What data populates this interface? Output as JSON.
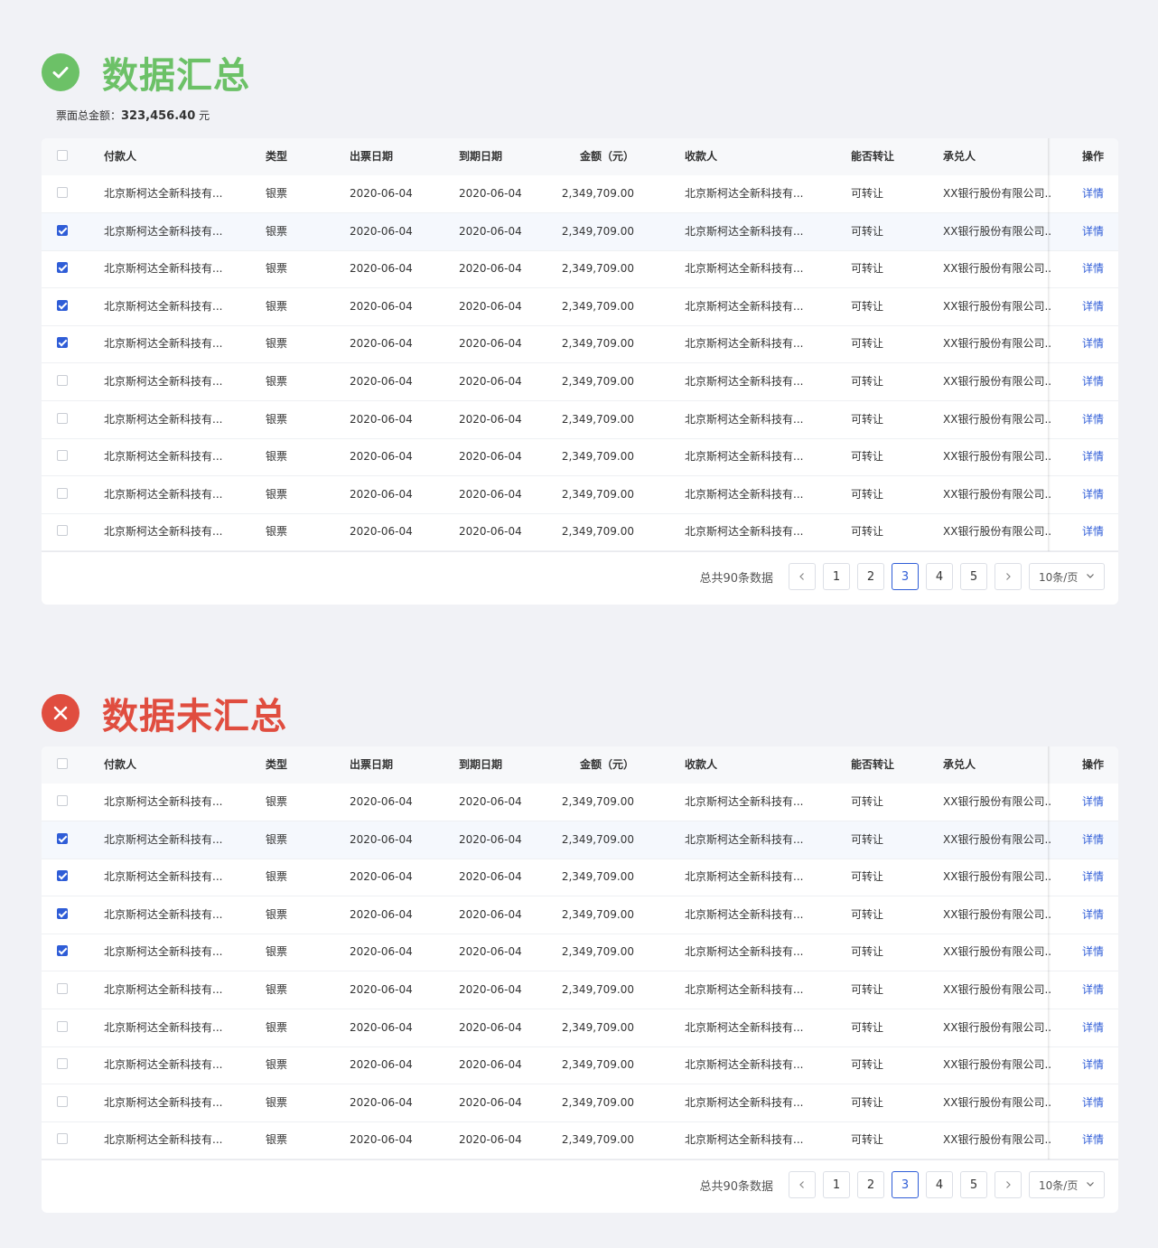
{
  "colors": {
    "success": "#6cc167",
    "error": "#e04d3f",
    "primary": "#2f5dd7"
  },
  "sections": [
    {
      "status": "success",
      "status_icon": "check-icon",
      "title": "数据汇总",
      "summary": {
        "label": "票面总金额：",
        "amount": "323,456.40",
        "unit": " 元"
      },
      "checked_rows": [
        1,
        2,
        3,
        4
      ],
      "highlight_row": 1
    },
    {
      "status": "error",
      "status_icon": "close-icon",
      "title": "数据未汇总",
      "checked_rows": [
        1,
        2,
        3,
        4
      ],
      "highlight_row": 1
    }
  ],
  "table": {
    "headers": {
      "payer": "付款人",
      "type": "类型",
      "issue_date": "出票日期",
      "due_date": "到期日期",
      "amount": "金额（元）",
      "payee": "收款人",
      "transferable": "能否转让",
      "acceptor": "承兑人",
      "action": "操作"
    },
    "rows": [
      {
        "payer": "北京斯柯达全新科技有...",
        "type": "银票",
        "issue_date": "2020-06-04",
        "due_date": "2020-06-04",
        "amount": "2,349,709.00",
        "payee": "北京斯柯达全新科技有...",
        "transferable": "可转让",
        "acceptor": "XX银行股份有限公司...",
        "action": "详情"
      },
      {
        "payer": "北京斯柯达全新科技有...",
        "type": "银票",
        "issue_date": "2020-06-04",
        "due_date": "2020-06-04",
        "amount": "2,349,709.00",
        "payee": "北京斯柯达全新科技有...",
        "transferable": "可转让",
        "acceptor": "XX银行股份有限公司...",
        "action": "详情"
      },
      {
        "payer": "北京斯柯达全新科技有...",
        "type": "银票",
        "issue_date": "2020-06-04",
        "due_date": "2020-06-04",
        "amount": "2,349,709.00",
        "payee": "北京斯柯达全新科技有...",
        "transferable": "可转让",
        "acceptor": "XX银行股份有限公司...",
        "action": "详情"
      },
      {
        "payer": "北京斯柯达全新科技有...",
        "type": "银票",
        "issue_date": "2020-06-04",
        "due_date": "2020-06-04",
        "amount": "2,349,709.00",
        "payee": "北京斯柯达全新科技有...",
        "transferable": "可转让",
        "acceptor": "XX银行股份有限公司...",
        "action": "详情"
      },
      {
        "payer": "北京斯柯达全新科技有...",
        "type": "银票",
        "issue_date": "2020-06-04",
        "due_date": "2020-06-04",
        "amount": "2,349,709.00",
        "payee": "北京斯柯达全新科技有...",
        "transferable": "可转让",
        "acceptor": "XX银行股份有限公司...",
        "action": "详情"
      },
      {
        "payer": "北京斯柯达全新科技有...",
        "type": "银票",
        "issue_date": "2020-06-04",
        "due_date": "2020-06-04",
        "amount": "2,349,709.00",
        "payee": "北京斯柯达全新科技有...",
        "transferable": "可转让",
        "acceptor": "XX银行股份有限公司...",
        "action": "详情"
      },
      {
        "payer": "北京斯柯达全新科技有...",
        "type": "银票",
        "issue_date": "2020-06-04",
        "due_date": "2020-06-04",
        "amount": "2,349,709.00",
        "payee": "北京斯柯达全新科技有...",
        "transferable": "可转让",
        "acceptor": "XX银行股份有限公司...",
        "action": "详情"
      },
      {
        "payer": "北京斯柯达全新科技有...",
        "type": "银票",
        "issue_date": "2020-06-04",
        "due_date": "2020-06-04",
        "amount": "2,349,709.00",
        "payee": "北京斯柯达全新科技有...",
        "transferable": "可转让",
        "acceptor": "XX银行股份有限公司...",
        "action": "详情"
      },
      {
        "payer": "北京斯柯达全新科技有...",
        "type": "银票",
        "issue_date": "2020-06-04",
        "due_date": "2020-06-04",
        "amount": "2,349,709.00",
        "payee": "北京斯柯达全新科技有...",
        "transferable": "可转让",
        "acceptor": "XX银行股份有限公司...",
        "action": "详情"
      },
      {
        "payer": "北京斯柯达全新科技有...",
        "type": "银票",
        "issue_date": "2020-06-04",
        "due_date": "2020-06-04",
        "amount": "2,349,709.00",
        "payee": "北京斯柯达全新科技有...",
        "transferable": "可转让",
        "acceptor": "XX银行股份有限公司...",
        "action": "详情"
      }
    ]
  },
  "pagination": {
    "total_text": "总共90条数据",
    "pages": [
      "1",
      "2",
      "3",
      "4",
      "5"
    ],
    "current": "3",
    "prev_icon": "chevron-left-icon",
    "next_icon": "chevron-right-icon",
    "page_size": "10条/页",
    "page_size_icon": "chevron-down-icon"
  }
}
